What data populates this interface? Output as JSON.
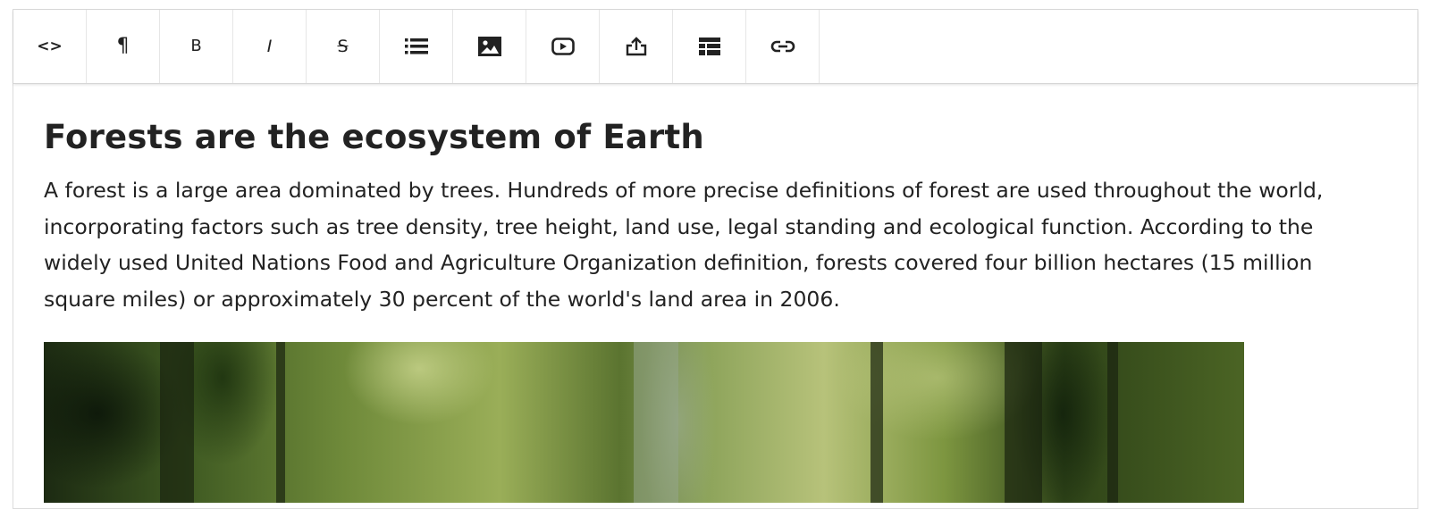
{
  "toolbar": {
    "buttons": [
      {
        "icon": "code-view-icon",
        "glyph": "<>",
        "label": "HTML"
      },
      {
        "icon": "paragraph-icon",
        "glyph": "¶",
        "label": "Format"
      },
      {
        "icon": "bold-icon",
        "glyph": "B",
        "label": "Bold"
      },
      {
        "icon": "italic-icon",
        "glyph": "I",
        "label": "Italic"
      },
      {
        "icon": "strikethrough-icon",
        "glyph": "S",
        "label": "Deleted"
      },
      {
        "icon": "list-icon",
        "label": "Lists"
      },
      {
        "icon": "image-icon",
        "label": "Image"
      },
      {
        "icon": "video-icon",
        "label": "Video"
      },
      {
        "icon": "file-upload-icon",
        "label": "File"
      },
      {
        "icon": "table-icon",
        "label": "Table"
      },
      {
        "icon": "link-icon",
        "label": "Link"
      }
    ]
  },
  "document": {
    "title": "Forests are the ecosystem of Earth",
    "paragraph": "A forest is a large area dominated by trees. Hundreds of more precise definitions of forest are used throughout the world, incorporating factors such as tree density, tree height, land use, legal standing and ecological function. According to the widely used United Nations Food and Agriculture Organization definition, forests covered four billion hectares (15 million square miles) or approximately 30 percent of the world's land area in 2006.",
    "image": "forest-photo"
  },
  "colors": {
    "text": "#222222",
    "border": "#dcdcdc",
    "background": "#ffffff"
  }
}
